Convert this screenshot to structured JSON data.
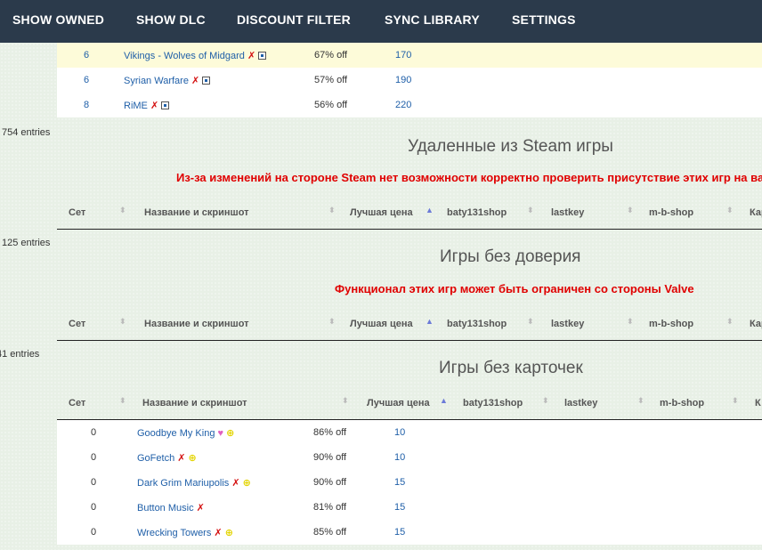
{
  "nav": {
    "items": [
      "SHOW OWNED",
      "SHOW DLC",
      "DISCOUNT FILTER",
      "SYNC LIBRARY",
      "SETTINGS"
    ]
  },
  "top_rows": [
    {
      "set": "6",
      "name": "Vikings - Wolves of Midgard",
      "discount": "67% off",
      "price": "170"
    },
    {
      "set": "6",
      "name": "Syrian Warfare",
      "discount": "57% off",
      "price": "190"
    },
    {
      "set": "8",
      "name": "RiME",
      "discount": "56% off",
      "price": "220"
    }
  ],
  "sections": [
    {
      "entries": "754 entries",
      "title": "Удаленные из Steam игры",
      "warning": "Из-за изменений на стороне Steam нет возможности корректно проверить присутствие этих игр на ва",
      "headers": [
        "Сет",
        "Название и скриншот",
        "Лучшая цена",
        "baty131shop",
        "lastkey",
        "m-b-shop",
        "Кар"
      ]
    },
    {
      "entries": "125 entries",
      "title": "Игры без доверия",
      "warning": "Функционал этих игр может быть ограничен со стороны Valve",
      "headers": [
        "Сет",
        "Название и скриншот",
        "Лучшая цена",
        "baty131shop",
        "lastkey",
        "m-b-shop",
        "Кар"
      ]
    },
    {
      "entries": "41 entries",
      "title": "Игры без карточек",
      "headers": [
        "Сет",
        "Название и скриншот",
        "Лучшая цена",
        "baty131shop",
        "lastkey",
        "m-b-shop",
        "К"
      ]
    }
  ],
  "bottom_rows": [
    {
      "set": "0",
      "name": "Goodbye My King",
      "discount": "86% off",
      "price": "10"
    },
    {
      "set": "0",
      "name": "GoFetch",
      "discount": "90% off",
      "price": "10"
    },
    {
      "set": "0",
      "name": "Dark Grim Mariupolis",
      "discount": "90% off",
      "price": "15"
    },
    {
      "set": "0",
      "name": "Button Music",
      "discount": "81% off",
      "price": "15"
    },
    {
      "set": "0",
      "name": "Wrecking Towers",
      "discount": "85% off",
      "price": "15"
    }
  ],
  "glyphs": {
    "x": "✗",
    "heart": "♥",
    "card": "⊕",
    "sort_up": "▲",
    "sort_both": "⬍"
  },
  "colors": {
    "navbar": "#2b3a4b",
    "link": "#1f5fa8",
    "warning": "#e00000",
    "highlight_row": "#fdfbd9"
  }
}
